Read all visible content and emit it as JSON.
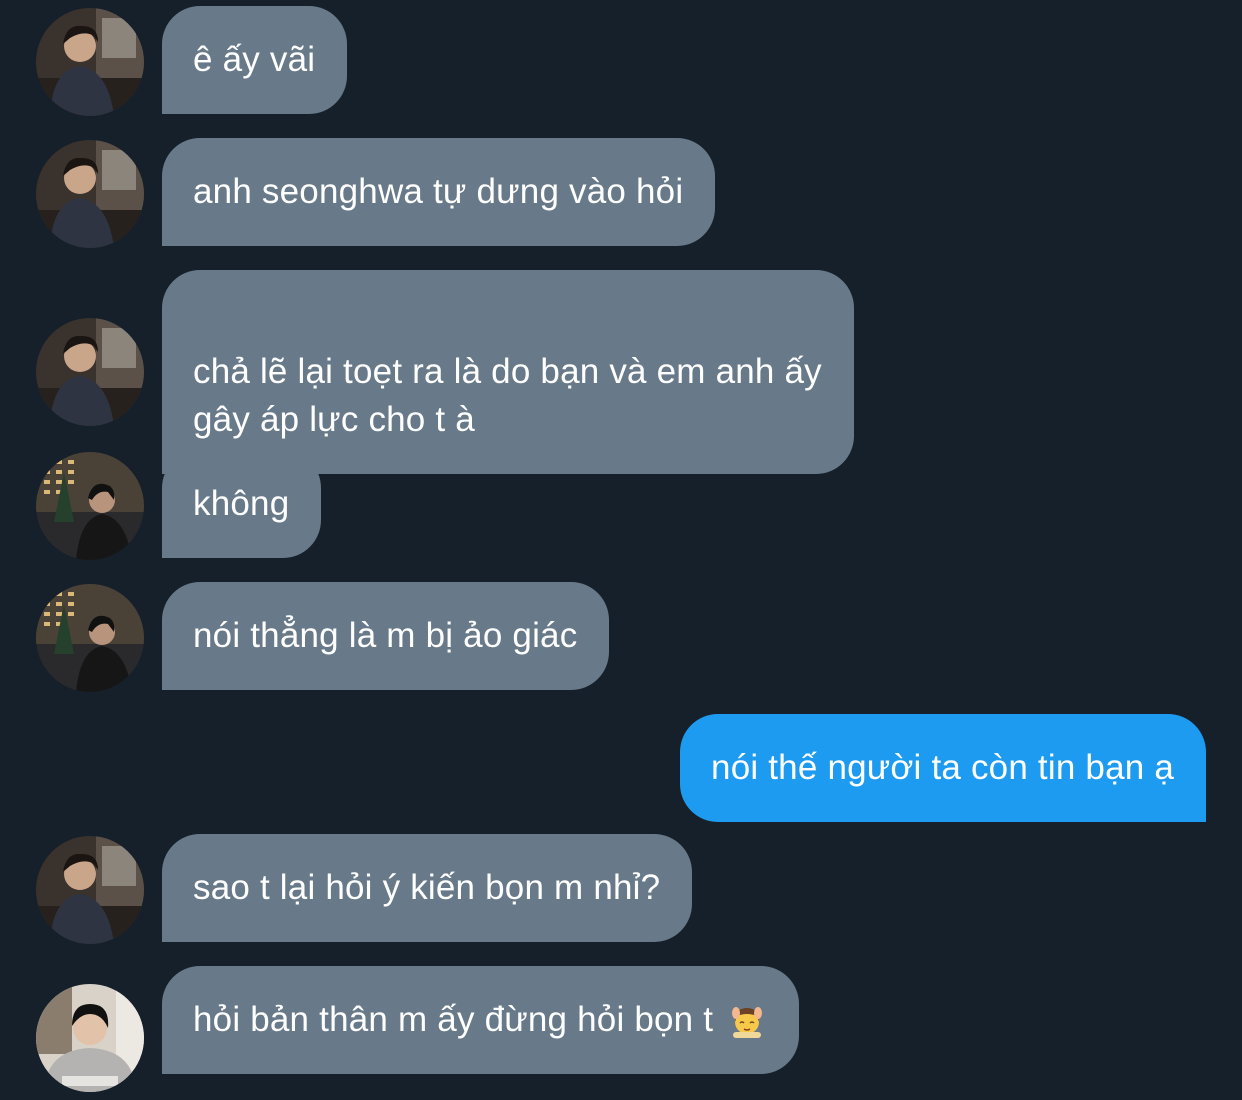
{
  "messages": [
    {
      "text": "ê ấy vãi",
      "direction": "incoming",
      "avatar": "avatar-man-dark-room"
    },
    {
      "text": "anh seonghwa tự dưng vào hỏi",
      "direction": "incoming",
      "avatar": "avatar-man-dark-room"
    },
    {
      "text": "chả lẽ lại toẹt ra là do bạn và em anh ấy\ngây áp lực cho t à",
      "direction": "incoming",
      "avatar": "avatar-man-dark-room"
    },
    {
      "text": "không",
      "direction": "incoming",
      "avatar": "avatar-man-night-city"
    },
    {
      "text": "nói thẳng là m bị ảo giác",
      "direction": "incoming",
      "avatar": "avatar-man-night-city"
    },
    {
      "text": "nói thế người ta còn tin bạn ạ",
      "direction": "outgoing"
    },
    {
      "text": "sao t lại hỏi ý kiến bọn m nhỉ?",
      "direction": "incoming",
      "avatar": "avatar-man-dark-room"
    },
    {
      "text": "hỏi bản thân m ấy đừng hỏi bọn t",
      "direction": "incoming",
      "avatar": "avatar-man-grey-hoodie",
      "emoji": "person-getting-massage-emoji"
    }
  ],
  "colors": {
    "background": "#16202b",
    "incoming_bubble": "#687a89",
    "outgoing_bubble": "#1d9bf0",
    "text": "#ffffff"
  }
}
